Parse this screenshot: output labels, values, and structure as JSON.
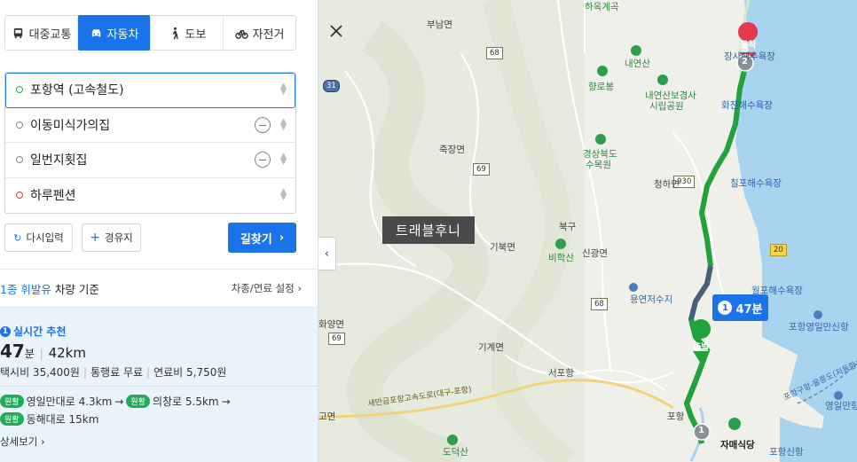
{
  "tabs": [
    {
      "label": "대중교통",
      "icon": "bus-icon"
    },
    {
      "label": "자동차",
      "icon": "car-icon",
      "active": true
    },
    {
      "label": "도보",
      "icon": "walk-icon"
    },
    {
      "label": "자전거",
      "icon": "bicycle-icon"
    }
  ],
  "stops": [
    {
      "label": "포항역 (고속철도)",
      "type": "start"
    },
    {
      "label": "이동미식가의집",
      "type": "via"
    },
    {
      "label": "일번지횟집",
      "type": "via"
    },
    {
      "label": "하루펜션",
      "type": "end"
    }
  ],
  "buttons": {
    "reset": "다시입력",
    "waypoint": "경유지",
    "search": "길찾기"
  },
  "vehicle": {
    "fuel": "1종 휘발유",
    "suffix": "차량 기준",
    "settings": "차종/연료 설정"
  },
  "result": {
    "rank": "1",
    "type": "실시간 추천",
    "minutes": "47",
    "minutes_unit": "분",
    "distance": "42km",
    "taxi": "택시비 35,400원",
    "toll": "통행료 무료",
    "fuel_cost": "연료비 5,750원",
    "tag": "원활",
    "road1": "영일만대로 4.3km",
    "road2": "의창로 5.5km",
    "road3": "동해대로 15km",
    "details": "상세보기"
  },
  "map": {
    "bubble_rank": "1",
    "bubble_time": "47분",
    "watermark": "트래블후니",
    "start_marker": "출발",
    "end_marker": "도착",
    "pin1": "1",
    "pin2": "2",
    "labels": {
      "bunam": "부남면",
      "jukjang": "죽장면",
      "gibuk": "기북면",
      "buk": "북구",
      "singwang": "신광면",
      "gigye": "기계면",
      "chunggang": "청하면",
      "naeyeonsan": "내연산",
      "hyangrobong": "향로봉",
      "naeyeon_park": "내연산보경사",
      "naeyeon_park2": "시립공원",
      "gyeongbuk": "경상북도",
      "gyeongbuk2": "수목원",
      "bihaksan": "비학산",
      "yongyeon": "용연저수지",
      "wolpo": "월포해수욕장",
      "hwajin": "화진해수욕장",
      "chilpo": "칠포해수욕장",
      "jangsa": "장사해수욕장",
      "seopohang": "서포항",
      "ic_pohang": "포항",
      "jamaesikdang": "자매식당",
      "pohang_yeongil": "포항영일만신항",
      "yeongilman": "영일만항",
      "hakdang": "하옥계곡",
      "dodeoksan": "도덕산",
      "hwayang": "화양면",
      "gomyeon": "고면",
      "expressway": "새만금포항고속도로(대구-포항)",
      "ferry": "포항구항-울릉도(저동항)",
      "pohang_new": "포항신항"
    },
    "shields": {
      "r68": "68",
      "r31": "31",
      "r69": "69",
      "r930": "930",
      "r20": "20",
      "r68b": "68",
      "r69b": "69"
    }
  }
}
